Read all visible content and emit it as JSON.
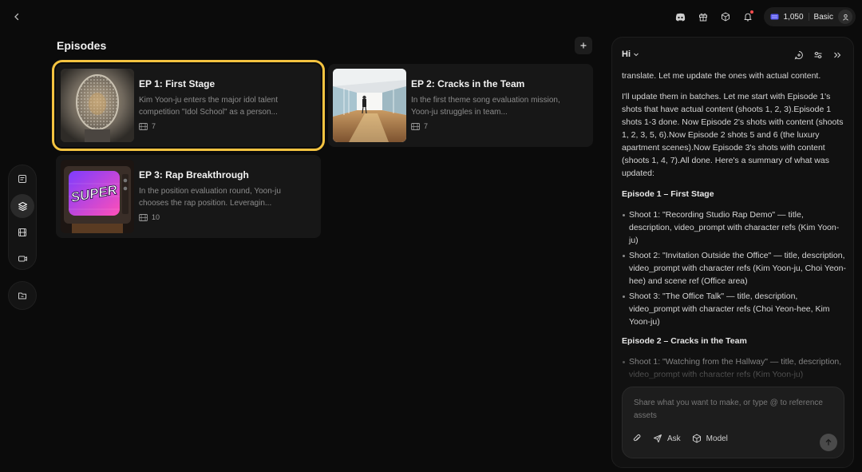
{
  "header": {
    "credits": "1,050",
    "plan": "Basic"
  },
  "main": {
    "title": "Episodes",
    "episodes": [
      {
        "title": "EP 1: First Stage",
        "description": "Kim Yoon-ju enters the major idol talent competition \"Idol School\" as a person...",
        "shots": "7"
      },
      {
        "title": "EP 2: Cracks in the Team",
        "description": "In the first theme song evaluation mission, Yoon-ju struggles in team...",
        "shots": "7"
      },
      {
        "title": "EP 3: Rap Breakthrough",
        "description": "In the position evaluation round, Yoon-ju chooses the rap position. Leveragin...",
        "shots": "10",
        "thumb_text": "SUPER"
      }
    ]
  },
  "chat": {
    "title": "Hi",
    "paragraphs": [
      "translate. Let me update the ones with actual content.",
      "I'll update them in batches. Let me start with Episode 1's shots that have actual content (shoots 1, 2, 3).Episode 1 shots 1-3 done. Now Episode 2's shots with content (shoots 1, 2, 3, 5, 6).Now Episode 2 shots 5 and 6 (the luxury apartment scenes).Now Episode 3's shots with content (shoots 1, 4, 7).All done. Here's a summary of what was updated:"
    ],
    "sections": [
      {
        "title": "Episode 1 – First Stage",
        "items": [
          "Shoot 1: \"Recording Studio Rap Demo\" — title, description, video_prompt with character refs (Kim Yoon-ju)",
          "Shoot 2: \"Invitation Outside the Office\" — title, description, video_prompt with character refs (Kim Yoon-ju, Choi Yeon-hee) and scene ref (Office area)",
          "Shoot 3: \"The Office Talk\" — title, description, video_prompt with character refs (Choi Yeon-hee, Kim Yoon-ju)"
        ]
      },
      {
        "title": "Episode 2 – Cracks in the Team",
        "items": [
          "Shoot 1: \"Watching from the Hallway\" — title, description, video_prompt with character refs (Kim Yoon-ju)"
        ]
      }
    ],
    "composer": {
      "placeholder": "Share what you want to make, or type @ to reference assets",
      "ask_label": "Ask",
      "model_label": "Model"
    }
  },
  "colors": {
    "accent_selected": "#f4c340",
    "background": "#0b0b0b",
    "card": "#171717",
    "notification_dot": "#ff4d4f"
  }
}
